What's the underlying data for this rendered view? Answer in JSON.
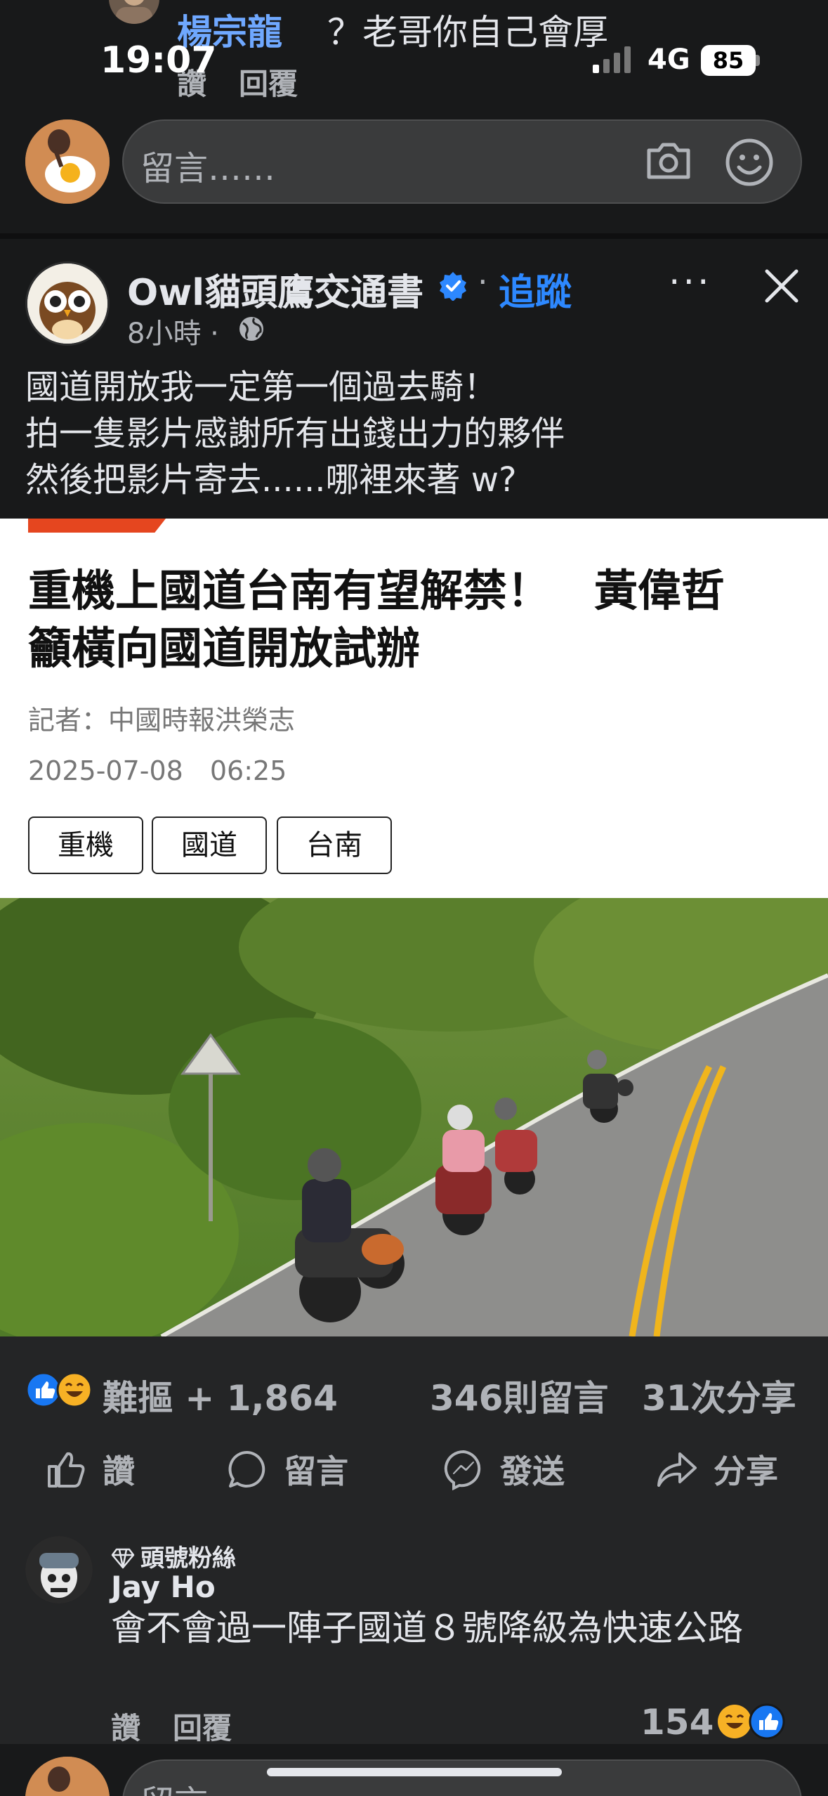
{
  "prev_comment": {
    "name": "楊宗龍",
    "text": "？老哥你自己會厚",
    "actions": [
      "讚",
      "回覆"
    ]
  },
  "status_bar": {
    "time": "19:07",
    "network": "4G",
    "battery": "85"
  },
  "composer": {
    "placeholder": "留言……"
  },
  "post": {
    "page_name": "Owl貓頭鷹交通書",
    "separator": "·",
    "follow_label": "追蹤",
    "more": "···",
    "time": "8小時 ·",
    "text": "國道開放我一定第一個過去騎！\n拍一隻影片感謝所有出錢出力的夥伴\n然後把影片寄去......哪裡來著 w?"
  },
  "article": {
    "title": "重機上國道台南有望解禁！　黃偉哲\n籲橫向國道開放試辦",
    "reporter": "記者：中國時報洪榮志",
    "date": "2025-07-08　06:25",
    "tags": [
      "重機",
      "國道",
      "台南"
    ]
  },
  "reactions": {
    "summary": "難摳 + 1,864",
    "comments": "346則留言",
    "shares": "31次分享"
  },
  "actions": {
    "like": "讚",
    "comment": "留言",
    "send": "發送",
    "share": "分享"
  },
  "top_comment": {
    "badge": "頭號粉絲",
    "name": "Jay Ho",
    "text": "會不會過一陣子國道８號降級為快速公路",
    "actions": [
      "讚",
      "回覆"
    ],
    "reaction_count": "154"
  },
  "bottom_composer": {
    "placeholder": "留言……"
  },
  "colors": {
    "background": "#18191a",
    "card": "#242526",
    "accent_blue": "#2d88ff",
    "article_red": "#e5461f"
  },
  "icons": [
    "camera-icon",
    "emoji-icon",
    "verified-badge-icon",
    "close-icon",
    "globe-icon",
    "like-icon",
    "comment-icon",
    "messenger-icon",
    "share-icon",
    "diamond-icon"
  ]
}
